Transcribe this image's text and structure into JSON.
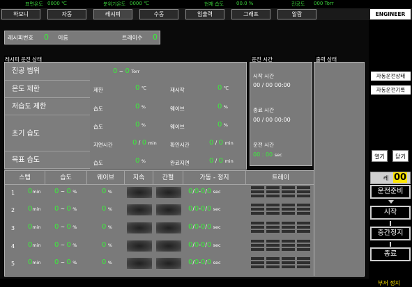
{
  "status": {
    "chamber_temp_label": "표면온도",
    "chamber_temp_value": "0000 ℃",
    "atm_temp_label": "분위기온도",
    "atm_temp_value": "0000 ℃",
    "humidity_label": "현재 습도",
    "humidity_value": "00.0 %",
    "vacuum_label": "진공도",
    "vacuum_value": "000 Torr"
  },
  "tabs": [
    "하모니",
    "자동",
    "레시피",
    "수동",
    "입출력",
    "그래프",
    "알람"
  ],
  "engineer_label": "ENGINEER",
  "recipe": {
    "no_label": "레시피번호",
    "no_value": "0",
    "name_label": "이름",
    "tray_label": "트레이수",
    "tray_value": "0"
  },
  "run_section_title": "레시피 운전 상태",
  "vacuum_row": {
    "label": "진공 범위",
    "from": "0",
    "tilde": "~",
    "to": "0",
    "unit": "Torr"
  },
  "temp_row": {
    "label": "온도 제한",
    "limit_label": "제한",
    "limit_value": "0",
    "limit_unit": "℃",
    "restart_label": "재시작",
    "restart_value": "0",
    "restart_unit": "℃"
  },
  "lowhum_row": {
    "label": "저습도 제한",
    "hum_label": "습도",
    "hum_value": "0",
    "hum_unit": "%",
    "wave_label": "웨이브",
    "wave_value": "0",
    "wave_unit": "%"
  },
  "init_row": {
    "label": "초기 습도",
    "hum_label": "습도",
    "hum_value": "0",
    "hum_unit": "%",
    "wave_label": "웨이브",
    "wave_value": "0",
    "wave_unit": "%",
    "wait_label": "지연시간",
    "wait_value": "0",
    "wait_slash": "/",
    "wait_value2": "0",
    "wait_unit": "min",
    "check_label": "확인시간",
    "check_value": "0",
    "check_slash": "/",
    "check_value2": "0",
    "check_unit": "min"
  },
  "target_row": {
    "label": "목표 습도",
    "hum_label": "습도",
    "hum_value": "0",
    "hum_unit": "%",
    "delay_label": "완료지연",
    "delay_value": "0",
    "delay_slash": "/",
    "delay_value2": "0",
    "delay_unit": "min"
  },
  "step_table": {
    "headers": [
      "스텝",
      "습도",
      "웨이브",
      "지속",
      "간헐",
      "가동 - 정지",
      "트레이"
    ],
    "steps": [
      {
        "no": "1",
        "time": "0",
        "time_unit": "min",
        "hum_from": "0",
        "hum_to": "0",
        "hum_unit": "%",
        "wave": "0",
        "wave_unit": "%",
        "run": "0",
        "run2": "0",
        "stop": "0",
        "stop2": "0",
        "sec": "sec"
      },
      {
        "no": "2",
        "time": "0",
        "time_unit": "min",
        "hum_from": "0",
        "hum_to": "0",
        "hum_unit": "%",
        "wave": "0",
        "wave_unit": "%",
        "run": "0",
        "run2": "0",
        "stop": "0",
        "stop2": "0",
        "sec": "sec"
      },
      {
        "no": "3",
        "time": "0",
        "time_unit": "min",
        "hum_from": "0",
        "hum_to": "0",
        "hum_unit": "%",
        "wave": "0",
        "wave_unit": "%",
        "run": "0",
        "run2": "0",
        "stop": "0",
        "stop2": "0",
        "sec": "sec"
      },
      {
        "no": "4",
        "time": "0",
        "time_unit": "min",
        "hum_from": "0",
        "hum_to": "0",
        "hum_unit": "%",
        "wave": "0",
        "wave_unit": "%",
        "run": "0",
        "run2": "0",
        "stop": "0",
        "stop2": "0",
        "sec": "sec"
      },
      {
        "no": "5",
        "time": "0",
        "time_unit": "min",
        "hum_from": "0",
        "hum_to": "0",
        "hum_unit": "%",
        "wave": "0",
        "wave_unit": "%",
        "run": "0",
        "run2": "0",
        "stop": "0",
        "stop2": "0",
        "sec": "sec"
      }
    ]
  },
  "time_panel": {
    "title": "운전 시간",
    "start_label": "시작 시간",
    "start_value": "00 / 00 00:00",
    "end_label": "종료 시간",
    "end_value": "00 / 00 00:00",
    "run_label": "운전 시간",
    "run_value": "00 : 00",
    "run_unit": "sec"
  },
  "output_panel": {
    "title": "출력 상태"
  },
  "side": {
    "auto_status": "자동운전상태",
    "auto_log": "자동운전기록",
    "open_label": "열기",
    "close_label": "닫기",
    "counter_label": "레",
    "counter_value": "00",
    "ready_label": "운전준비",
    "start_label": "시작",
    "pause_label": "중간정지",
    "end_label": "종료",
    "bottom_label": "부저 정지"
  },
  "colors": {
    "value_green": "#3af03a",
    "panel_gray": "#7a7a7a",
    "background": "#000000"
  }
}
